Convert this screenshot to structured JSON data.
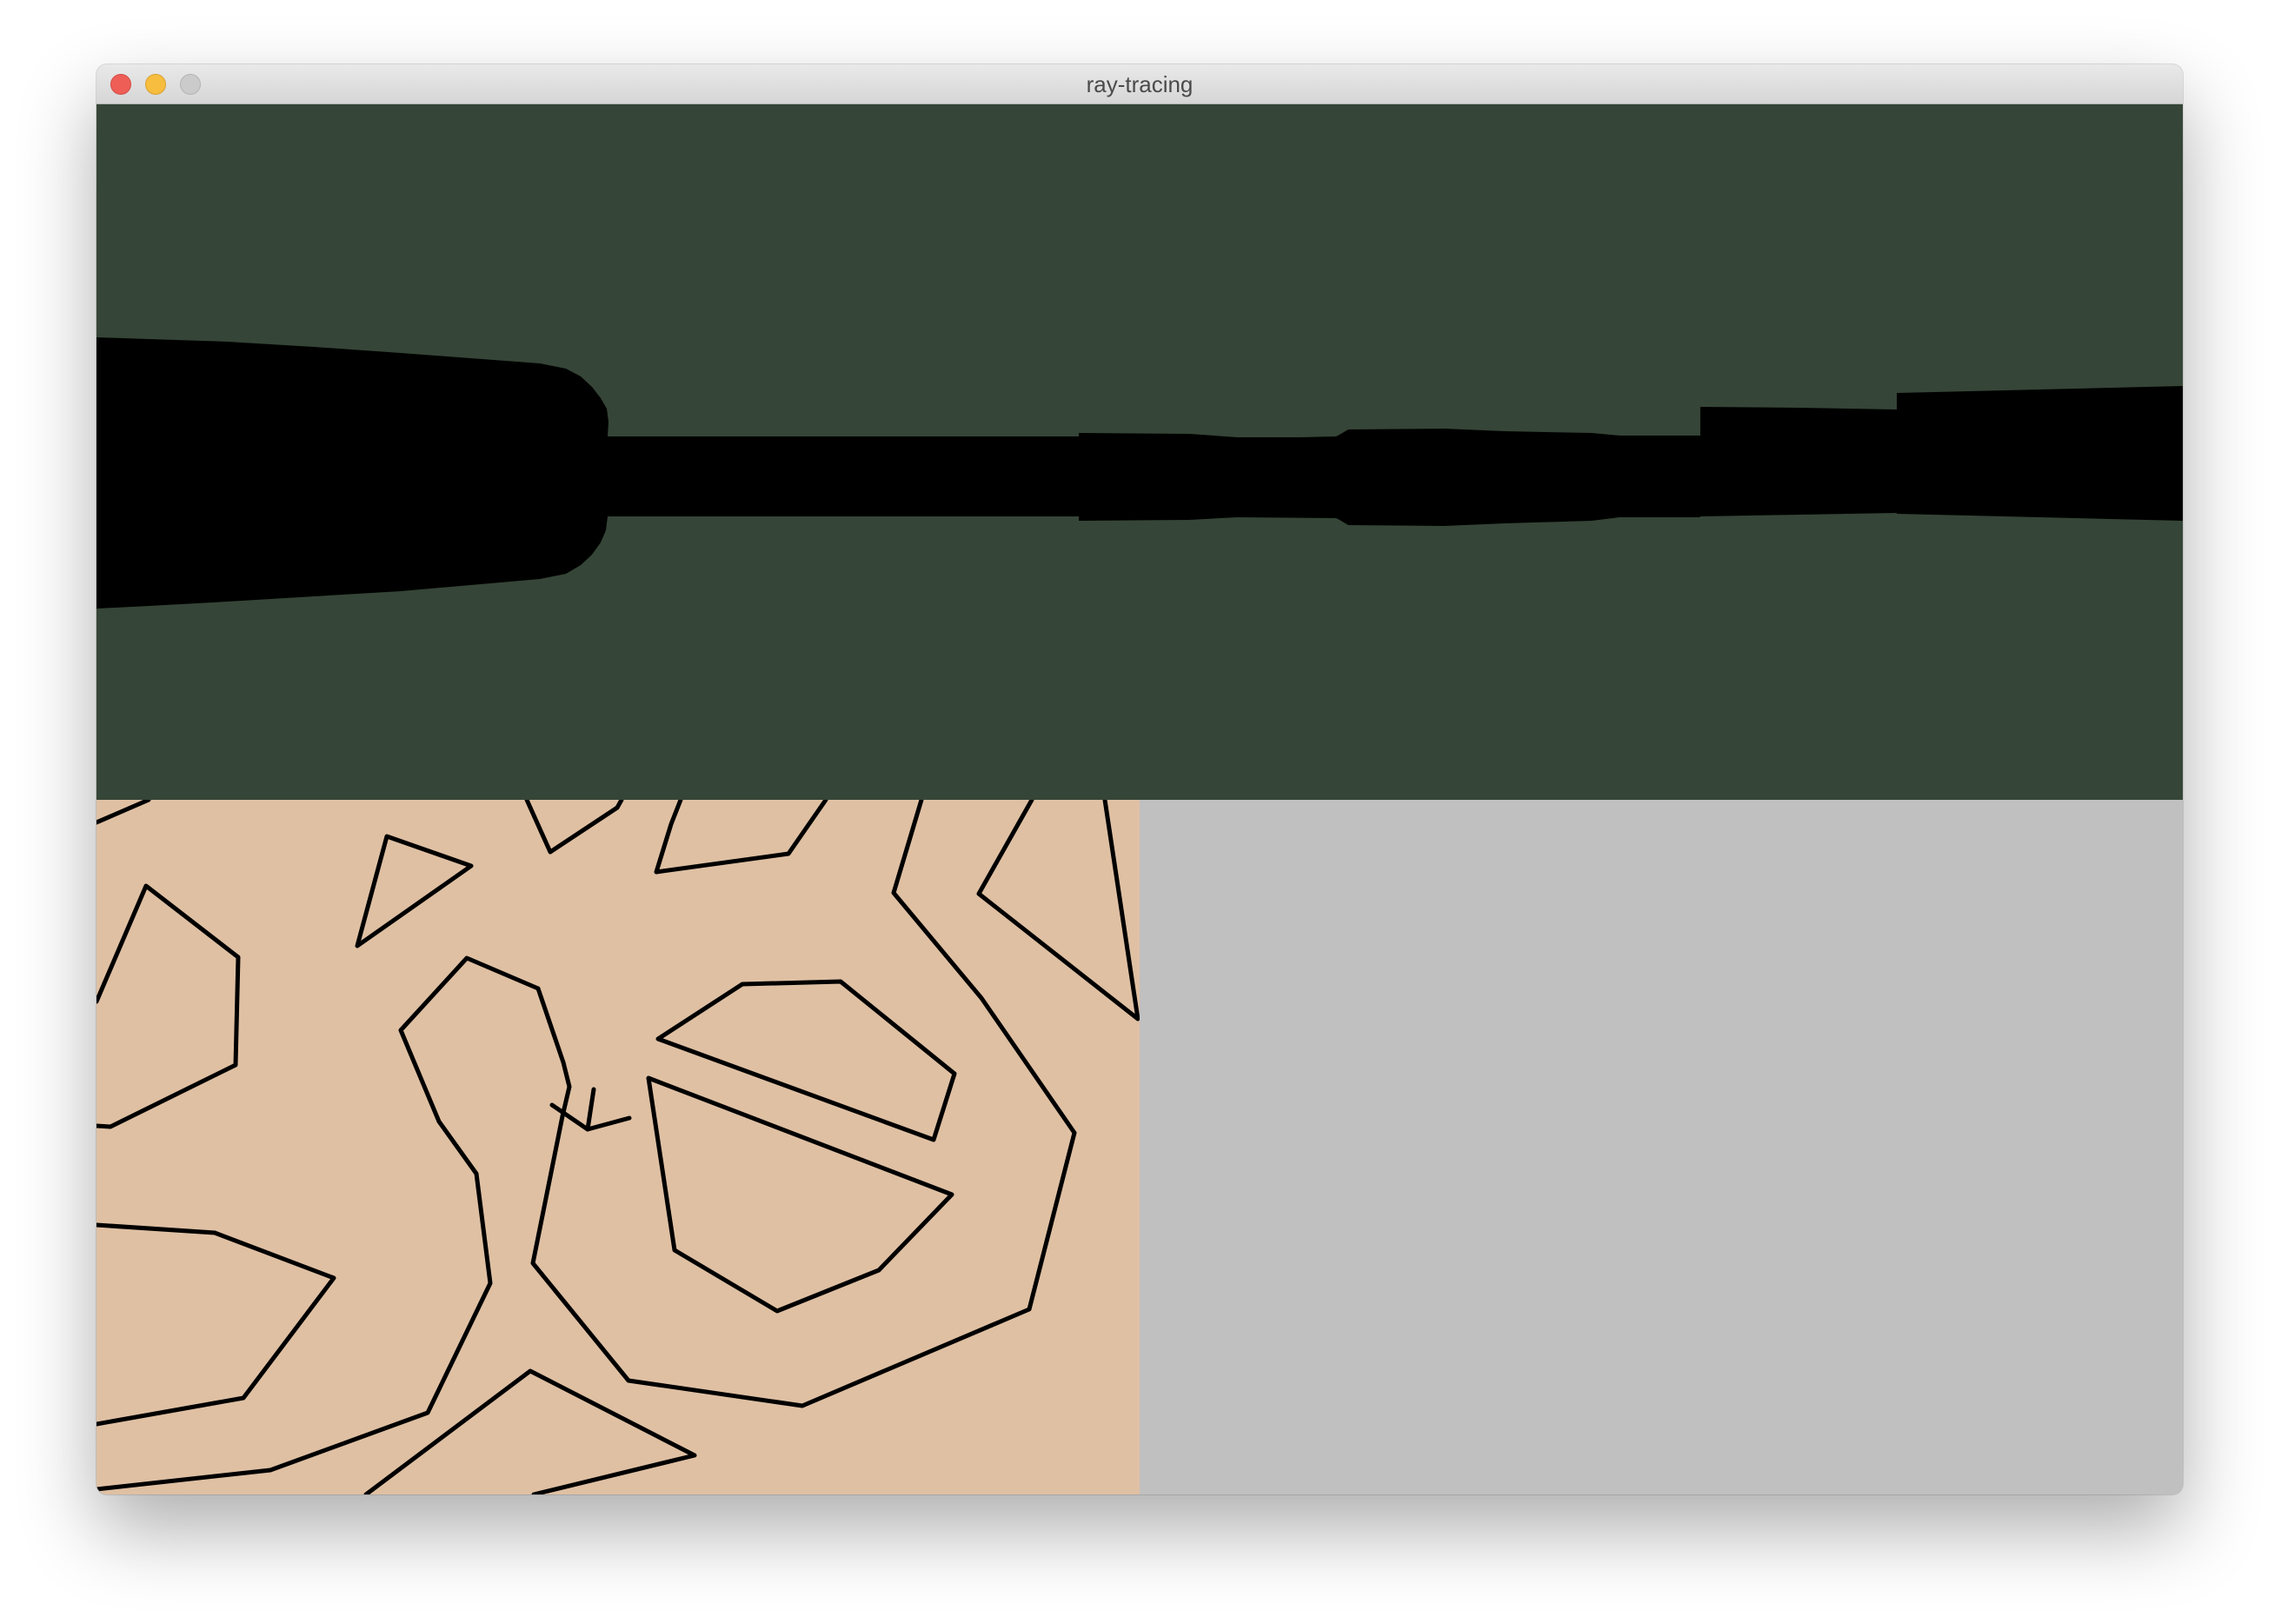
{
  "window": {
    "title": "ray-tracing"
  },
  "colors": {
    "render_background": "#354537",
    "render_shadow": "#000000",
    "map_background": "#dfc0a3",
    "map_walls": "#000000",
    "empty_pane": "#c0c0c0"
  },
  "icons": {
    "close": "close-icon",
    "minimize": "minimize-icon",
    "zoom": "zoom-icon"
  }
}
